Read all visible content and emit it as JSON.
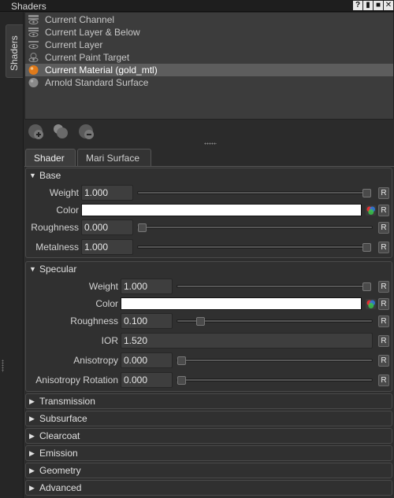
{
  "window": {
    "title": "Shaders",
    "buttons": [
      "?",
      "▮",
      "■",
      "✕"
    ]
  },
  "side_tab": {
    "label": "Shaders"
  },
  "shader_list": [
    {
      "label": "Current Channel",
      "icon": "channel-eye-icon",
      "selected": false
    },
    {
      "label": "Current Layer & Below",
      "icon": "layer-eye-icon",
      "selected": false
    },
    {
      "label": "Current Layer",
      "icon": "layer-eye-icon",
      "selected": false
    },
    {
      "label": "Current Paint Target",
      "icon": "paint-target-eye-icon",
      "selected": false
    },
    {
      "label": "Current Material (gold_mtl)",
      "icon": "material-ball-orange-icon",
      "selected": true
    },
    {
      "label": "Arnold Standard Surface",
      "icon": "material-ball-grey-icon",
      "selected": false
    }
  ],
  "toolbar": {
    "icons": [
      "add-shader-icon",
      "duplicate-shader-icon",
      "remove-shader-icon"
    ]
  },
  "tabs": [
    {
      "label": "Shader",
      "active": true
    },
    {
      "label": "Mari Surface",
      "active": false
    }
  ],
  "reset_label": "R",
  "groups": {
    "base": {
      "title": "Base",
      "expanded": true,
      "weight": {
        "label": "Weight",
        "value": "1.000",
        "fraction": 1.0
      },
      "color": {
        "label": "Color",
        "value_hex": "#ffffff"
      },
      "roughness": {
        "label": "Roughness",
        "value": "0.000",
        "fraction": 0.0
      },
      "metalness": {
        "label": "Metalness",
        "value": "1.000",
        "fraction": 1.0
      }
    },
    "specular": {
      "title": "Specular",
      "expanded": true,
      "weight": {
        "label": "Weight",
        "value": "1.000",
        "fraction": 1.0
      },
      "color": {
        "label": "Color",
        "value_hex": "#ffffff"
      },
      "roughness": {
        "label": "Roughness",
        "value": "0.100",
        "fraction": 0.1
      },
      "ior": {
        "label": "IOR",
        "value": "1.520"
      },
      "anisotropy": {
        "label": "Anisotropy",
        "value": "0.000",
        "fraction": 0.0
      },
      "anisotropy_rotation": {
        "label": "Anisotropy Rotation",
        "value": "0.000",
        "fraction": 0.0
      }
    },
    "collapsed": [
      {
        "title": "Transmission"
      },
      {
        "title": "Subsurface"
      },
      {
        "title": "Clearcoat"
      },
      {
        "title": "Emission"
      },
      {
        "title": "Geometry"
      },
      {
        "title": "Advanced"
      }
    ]
  },
  "colors": {
    "selected_row": "#5d5d5d",
    "material_ball": "#e07a1a",
    "panel_bg": "#2d2d2d"
  }
}
